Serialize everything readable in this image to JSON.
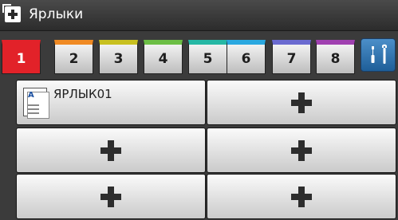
{
  "header": {
    "title": "Ярлыки",
    "icon": "shortcut-add-icon"
  },
  "tabs": [
    {
      "label": "1",
      "color": "#e22229",
      "active": true
    },
    {
      "label": "2",
      "color": "#f08a24"
    },
    {
      "label": "3",
      "color": "#c8c020"
    },
    {
      "label": "4",
      "color": "#6cbe45"
    },
    {
      "label": "5",
      "color": "#26b8a5"
    },
    {
      "label": "6",
      "color": "#2aa8e0"
    },
    {
      "label": "7",
      "color": "#6a6ad0"
    },
    {
      "label": "8",
      "color": "#a040b0"
    }
  ],
  "settings": {
    "icon": "wrench-screwdriver-icon",
    "color": "#2c7bc4"
  },
  "shortcuts": [
    {
      "label": "ЯРЛЫК01",
      "icon": "document-icon"
    },
    {
      "label": "",
      "icon": "plus-icon"
    },
    {
      "label": "",
      "icon": "plus-icon"
    },
    {
      "label": "",
      "icon": "plus-icon"
    },
    {
      "label": "",
      "icon": "plus-icon"
    },
    {
      "label": "",
      "icon": "plus-icon"
    }
  ]
}
